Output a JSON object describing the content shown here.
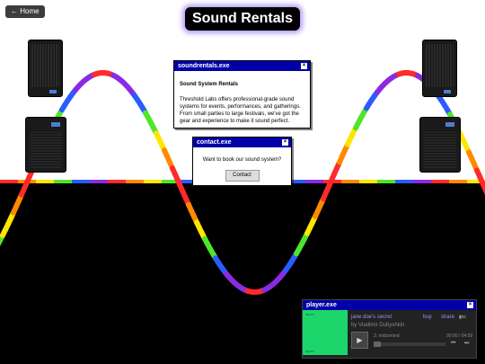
{
  "home": {
    "label": "← Home"
  },
  "title": "Sound Rentals",
  "info_window": {
    "title": "soundrentals.exe",
    "close": "×",
    "heading": "Sound System Rentals",
    "text": "Threshold Labs offers professional-grade sound systems for events, performances, and gatherings. From small parties to large festivals, we've got the gear and experience to make it sound perfect."
  },
  "contact_window": {
    "title": "contact.exe",
    "close": "×",
    "text": "Want to book our sound system?",
    "button": "Contact"
  },
  "player": {
    "title": "player.exe",
    "close": "×",
    "art_top": "tapes",
    "art_bottom": "tapes",
    "track_title": "jane doe's secret",
    "artist": "by Vladimir Dubyshkin",
    "buy": "buy",
    "share": "share",
    "bandcamp": "▮bc",
    "track": "3. midcentral",
    "time": "00:00 / 04:59",
    "progress": 0.0,
    "play_icon": "▶",
    "prev_icon": "⏮",
    "next_icon": "⏭"
  },
  "rainbow_colors": [
    "#ff2a2a",
    "#ff8a00",
    "#ffe600",
    "#4ee62a",
    "#2a5cff",
    "#8a2be2"
  ]
}
